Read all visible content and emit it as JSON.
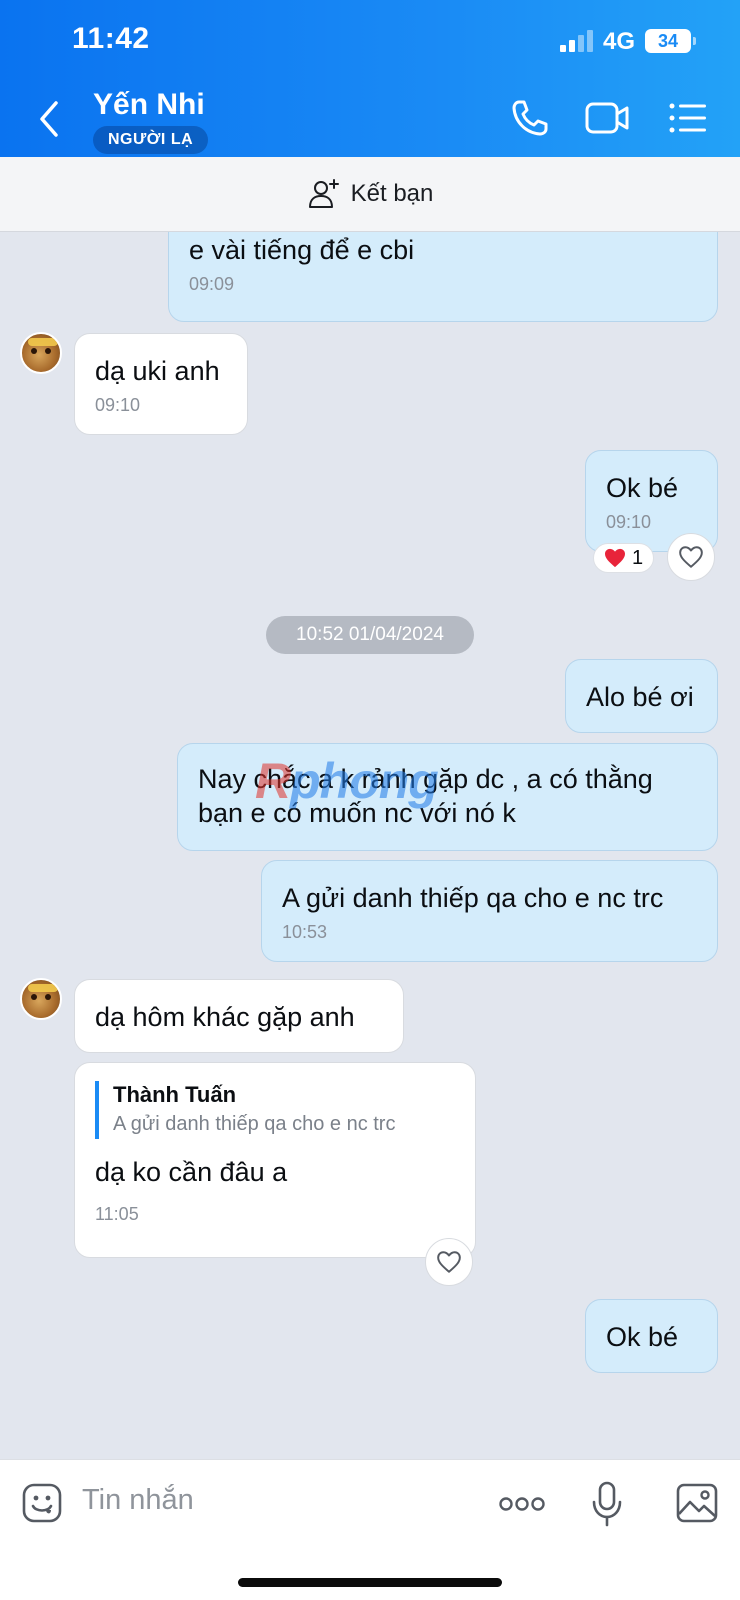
{
  "status_bar": {
    "time": "11:42",
    "network": "4G",
    "battery": "34"
  },
  "header": {
    "contact_name": "Yến Nhi",
    "badge": "NGƯỜI LẠ"
  },
  "friend_bar": {
    "label": "Kết bạn"
  },
  "messages": [
    {
      "text": "e vài tiếng để e cbi",
      "time": "09:09",
      "direction": "outgoing"
    },
    {
      "text": "dạ uki anh",
      "time": "09:10",
      "direction": "incoming"
    },
    {
      "text": "Ok bé",
      "time": "09:10",
      "direction": "outgoing",
      "reaction": {
        "emoji": "heart",
        "count": "1"
      }
    },
    {
      "text": "Alo bé ơi",
      "direction": "outgoing"
    },
    {
      "text": "Nay chắc a k rảnh gặp dc , a có thằng bạn e có muốn nc với nó k",
      "direction": "outgoing"
    },
    {
      "text": "A gửi danh thiếp qa cho e nc trc",
      "time": "10:53",
      "direction": "outgoing"
    },
    {
      "text": "dạ hôm khác gặp anh",
      "direction": "incoming"
    },
    {
      "text": "dạ ko cần đâu a",
      "time": "11:05",
      "direction": "incoming",
      "quote": {
        "author": "Thành Tuấn",
        "text": "A gửi danh thiếp qa cho e nc trc"
      }
    },
    {
      "text": "Ok bé",
      "direction": "outgoing"
    }
  ],
  "date_separator": "10:52 01/04/2024",
  "watermark": {
    "first": "R",
    "rest": "phong"
  },
  "input": {
    "placeholder": "Tin nhắn"
  },
  "colors": {
    "header_start": "#0a73f0",
    "header_end": "#23a2f7",
    "outgoing_bubble": "#d4ecfb",
    "incoming_bubble": "#ffffff",
    "chat_bg": "#e2e6ee"
  },
  "icons": [
    "back-icon",
    "phone-icon",
    "video-call-icon",
    "menu-list-icon",
    "add-friend-icon",
    "heart-reaction-icon",
    "heart-outline-icon",
    "sticker-icon",
    "more-icon",
    "microphone-icon",
    "image-icon"
  ]
}
